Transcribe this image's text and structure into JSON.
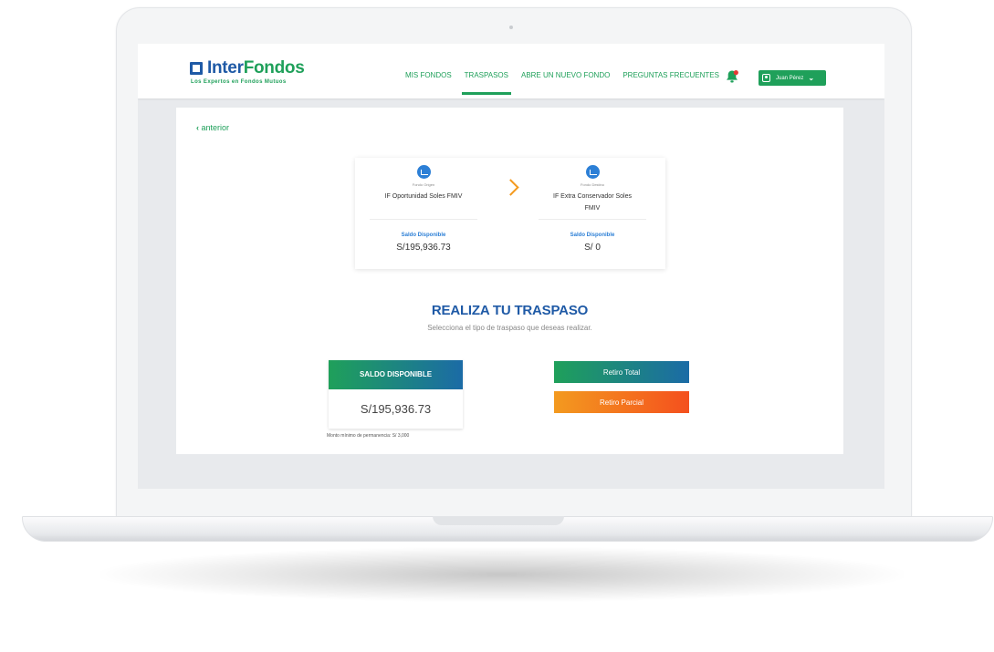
{
  "brand": {
    "name_main": "Inter",
    "name_accent": "Fondos",
    "tagline": "Los Expertos en Fondos Mutuos"
  },
  "nav": {
    "items": [
      "MIS FONDOS",
      "TRASPASOS",
      "ABRE UN NUEVO FONDO",
      "PREGUNTAS FRECUENTES"
    ],
    "active_index": 1,
    "user_label": "Juan Pérez"
  },
  "back_label": "anterior",
  "origin_fund": {
    "caption": "Fondo Origen",
    "name": "IF Oportunidad Soles FMIV",
    "saldo_label": "Saldo Disponible",
    "saldo_value": "S/195,936.73"
  },
  "dest_fund": {
    "caption": "Fondo Destino",
    "name": "IF Extra Conservador Soles FMIV",
    "saldo_label": "Saldo Disponible",
    "saldo_value": "S/ 0"
  },
  "section": {
    "title": "REALIZA TU TRASPASO",
    "subtitle": "Selecciona el tipo de traspaso que deseas realizar."
  },
  "saldo_box": {
    "header": "SALDO DISPONIBLE",
    "value": "S/195,936.73",
    "note": "Monto mínimo de permanencia: S/ 3,000"
  },
  "buttons": {
    "total_label": "Retiro Total",
    "parcial_label": "Retiro Parcial"
  },
  "icons": {
    "bell": "notification-bell-icon",
    "user": "user-icon",
    "fund": "chart-icon",
    "arrow": "chevron-right-icon",
    "back": "chevron-left-icon"
  },
  "colors": {
    "brand_blue": "#1f5aa6",
    "brand_green": "#1fa05a",
    "accent_orange": "#f49a1f",
    "notification_dot": "#e53935"
  }
}
